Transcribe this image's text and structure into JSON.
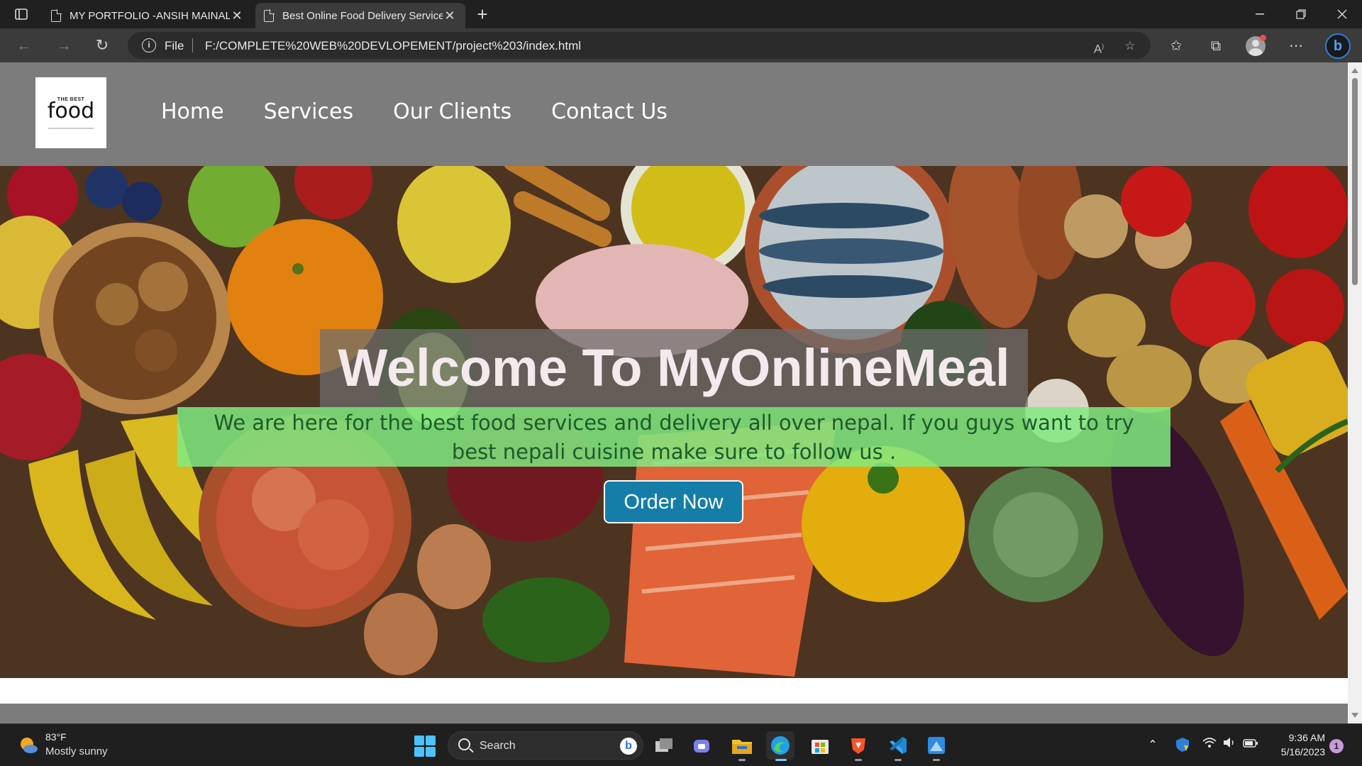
{
  "browser": {
    "tabs": [
      {
        "label": "MY PORTFOLIO -ANSIH MAINALI",
        "active": false
      },
      {
        "label": "Best Online Food Delivery Service",
        "active": true
      }
    ],
    "new_tab_symbol": "+",
    "address": {
      "scheme_label": "File",
      "url": "F:/COMPLETE%20WEB%20DEVLOPEMENT/project%203/index.html"
    }
  },
  "site": {
    "logo": {
      "small_text": "THE BEST",
      "big_text": "food"
    },
    "nav": [
      "Home",
      "Services",
      "Our Clients",
      "Contact Us"
    ],
    "hero": {
      "title": "Welcome To MyOnlineMeal",
      "description": "We are here for the best food services and delivery all over nepal. If you guys want to try best nepali cuisine make sure to follow us .",
      "cta": "Order Now"
    },
    "colors": {
      "header_bg": "#7c7c7c",
      "cta_bg": "#147ea8",
      "desc_bg": "#80eb80",
      "desc_text": "#1f5a2b"
    }
  },
  "taskbar": {
    "weather": {
      "temp": "83°F",
      "desc": "Mostly sunny"
    },
    "search_placeholder": "Search",
    "apps": [
      "task-view-icon",
      "teams-icon",
      "file-explorer-icon",
      "edge-icon",
      "store-icon",
      "brave-icon",
      "vscode-icon",
      "paint-icon"
    ],
    "clock": {
      "time": "9:36 AM",
      "date": "5/16/2023"
    },
    "notification_count": "1"
  }
}
